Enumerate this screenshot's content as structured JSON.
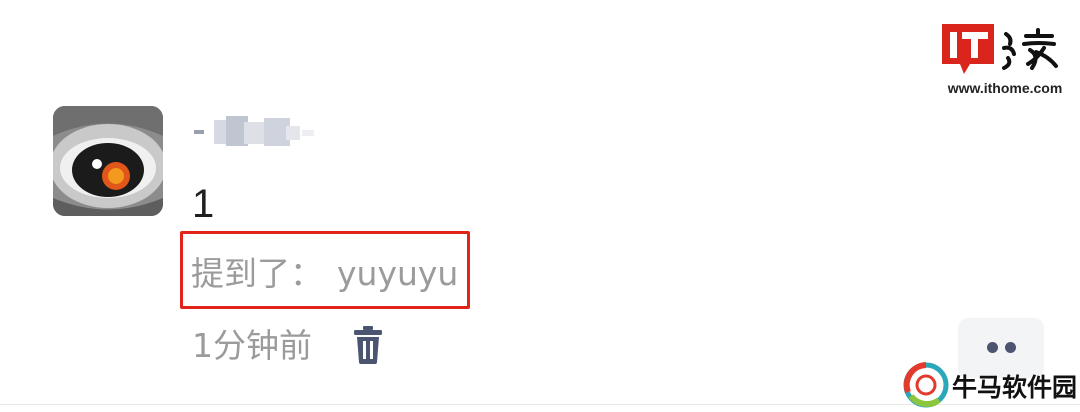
{
  "comment": {
    "content": "1",
    "mention_label": "提到了：",
    "mention_user": "yuyuyu",
    "timestamp": "1分钟前"
  },
  "icons": {
    "avatar": "eye-avatar",
    "delete": "trash-icon",
    "more": "more-dots-icon"
  },
  "colors": {
    "highlight_box": "#e2231a",
    "secondary_text": "#9b9b9b",
    "icon_color": "#4b5470"
  },
  "watermarks": {
    "ithome_url": "www.ithome.com",
    "site_name": "牛马软件园"
  }
}
